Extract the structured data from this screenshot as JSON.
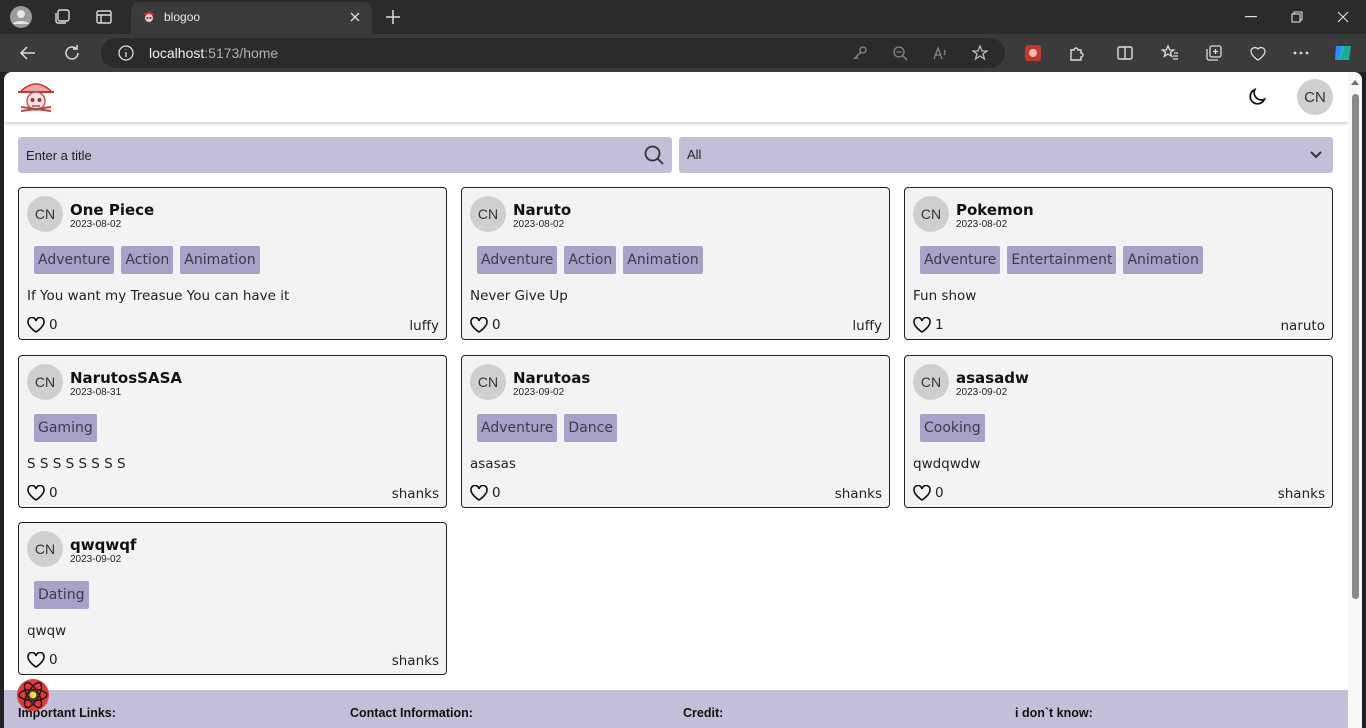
{
  "browser": {
    "tab_title": "blogoo",
    "url_host": "localhost",
    "url_path": ":5173/home"
  },
  "header": {
    "avatar_initials": "CN"
  },
  "filters": {
    "search_placeholder": "Enter a title",
    "category_value": "All"
  },
  "posts": [
    {
      "initials": "CN",
      "title": "One Piece",
      "date": "2023-08-02",
      "tags": [
        "Adventure",
        "Action",
        "Animation"
      ],
      "body": "If You want my Treasue You can have it",
      "likes": "0",
      "author": "luffy"
    },
    {
      "initials": "CN",
      "title": "Naruto",
      "date": "2023-08-02",
      "tags": [
        "Adventure",
        "Action",
        "Animation"
      ],
      "body": "Never Give Up",
      "likes": "0",
      "author": "luffy"
    },
    {
      "initials": "CN",
      "title": "Pokemon",
      "date": "2023-08-02",
      "tags": [
        "Adventure",
        "Entertainment",
        "Animation"
      ],
      "body": "Fun show",
      "likes": "1",
      "author": "naruto"
    },
    {
      "initials": "CN",
      "title": "NarutosSASA",
      "date": "2023-08-31",
      "tags": [
        "Gaming"
      ],
      "body": "S S S S S S S S",
      "likes": "0",
      "author": "shanks"
    },
    {
      "initials": "CN",
      "title": "Narutoas",
      "date": "2023-09-02",
      "tags": [
        "Adventure",
        "Dance"
      ],
      "body": "asasas",
      "likes": "0",
      "author": "shanks"
    },
    {
      "initials": "CN",
      "title": "asasadw",
      "date": "2023-09-02",
      "tags": [
        "Cooking"
      ],
      "body": "qwdqwdw",
      "likes": "0",
      "author": "shanks"
    },
    {
      "initials": "CN",
      "title": "qwqwqf",
      "date": "2023-09-02",
      "tags": [
        "Dating"
      ],
      "body": "qwqw",
      "likes": "0",
      "author": "shanks"
    }
  ],
  "footer": {
    "columns": [
      "Important Links:",
      "Contact Information:",
      "Credit:",
      "i don`t know:"
    ]
  }
}
